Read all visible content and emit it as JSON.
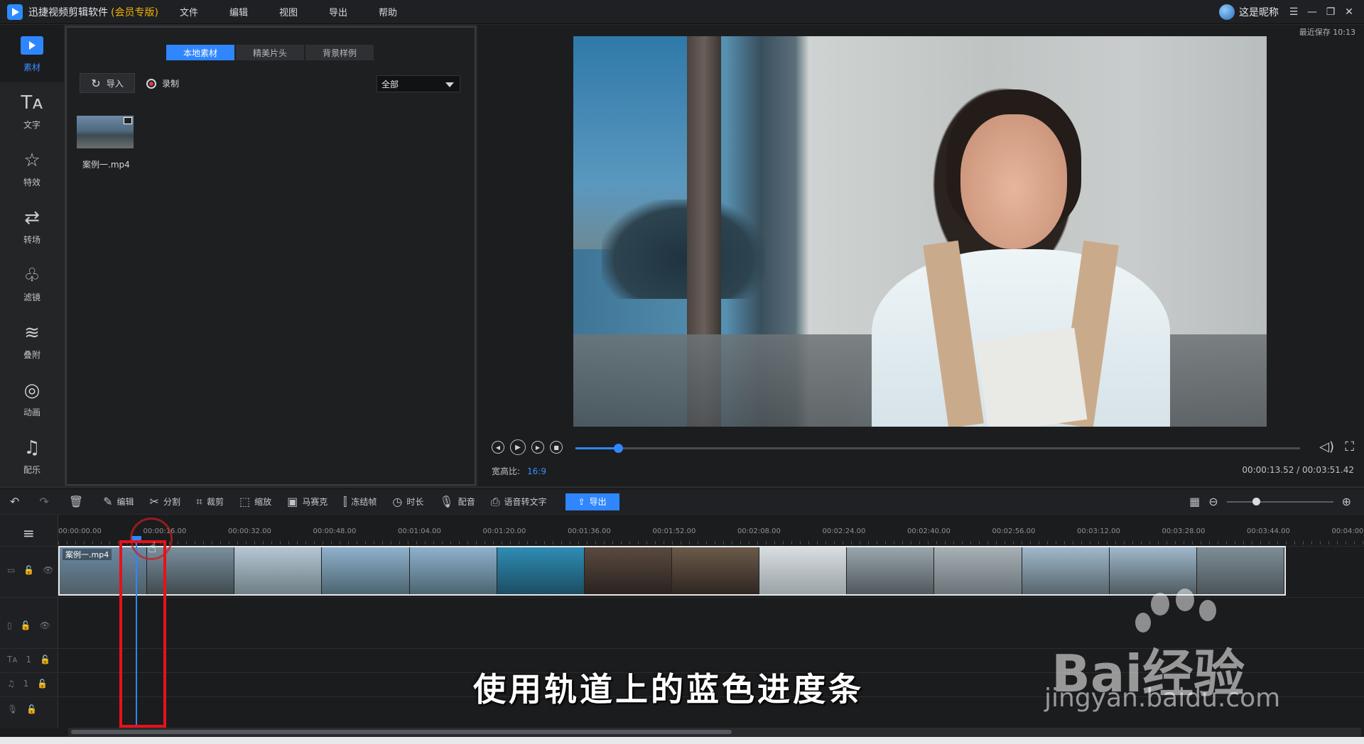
{
  "app": {
    "name": "迅捷视频剪辑软件",
    "edition": "(会员专版)",
    "menu": [
      "文件",
      "编辑",
      "视图",
      "导出",
      "帮助"
    ],
    "user": "这是昵称",
    "autosave": "最近保存 10:13"
  },
  "rail": [
    {
      "label": "素材",
      "icon": "media-icon"
    },
    {
      "label": "文字",
      "icon": "text-icon"
    },
    {
      "label": "特效",
      "icon": "effects-icon"
    },
    {
      "label": "转场",
      "icon": "transition-icon"
    },
    {
      "label": "滤镜",
      "icon": "filter-icon"
    },
    {
      "label": "叠附",
      "icon": "overlay-icon"
    },
    {
      "label": "动画",
      "icon": "animation-icon"
    },
    {
      "label": "配乐",
      "icon": "music-icon"
    }
  ],
  "media": {
    "tabs": [
      "本地素材",
      "精美片头",
      "背景样例"
    ],
    "import_label": "导入",
    "record_label": "录制",
    "filter_value": "全部",
    "clip_name": "案例一.mp4"
  },
  "preview": {
    "aspect_label": "宽高比:",
    "aspect_value": "16:9",
    "timecode": "00:00:13.52 / 00:03:51.42",
    "progress": 0.059
  },
  "toolbar": {
    "tools": [
      "编辑",
      "分割",
      "裁剪",
      "缩放",
      "马赛克",
      "冻结帧",
      "时长",
      "配音",
      "语音转文字"
    ],
    "export_label": "导出"
  },
  "timeline": {
    "ticks": [
      "00:00:00.00",
      "00:00:16.00",
      "00:00:32.00",
      "00:00:48.00",
      "00:01:04.00",
      "00:01:20.00",
      "00:01:36.00",
      "00:01:52.00",
      "00:02:08.00",
      "00:02:24.00",
      "00:02:40.00",
      "00:02:56.00",
      "00:03:12.00",
      "00:03:28.00",
      "00:03:44.00",
      "00:04:00"
    ],
    "clip_label": "案例一.mp4",
    "track_numbers": [
      "1",
      "1",
      "1"
    ]
  },
  "overlay": {
    "subtitle": "使用轨道上的蓝色进度条",
    "watermark_main": "Bai经验",
    "watermark_sub": "jingyan.baidu.com"
  },
  "colors": {
    "accent": "#2f86ff",
    "highlight": "#e8111a",
    "vip": "#f0b400"
  }
}
